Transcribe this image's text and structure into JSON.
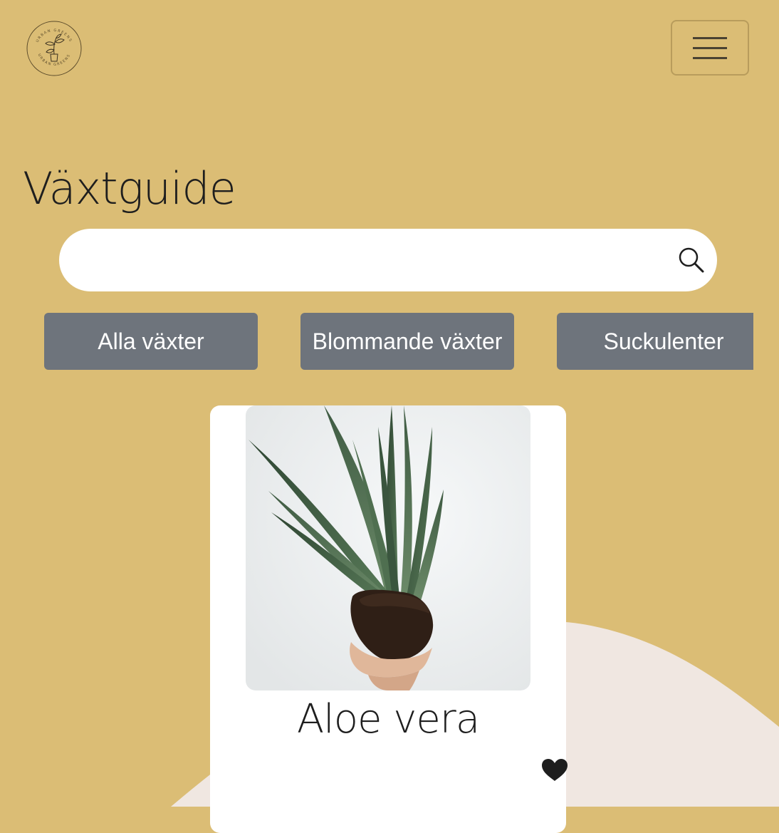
{
  "colors": {
    "background": "#dbbd75",
    "wave": "#f0e7e1",
    "filter_button": "#6e747c",
    "card": "#ffffff",
    "text": "#1e1e1e"
  },
  "header": {
    "logo_icon": "urban-greens-plant-logo",
    "logo_text": "URBAN GREENS",
    "menu_icon": "hamburger-icon"
  },
  "page": {
    "title": "Växtguide"
  },
  "search": {
    "value": "",
    "placeholder": "",
    "icon": "search-icon"
  },
  "filters": [
    {
      "label": "Alla växter"
    },
    {
      "label": "Blommande växter"
    },
    {
      "label": "Suckulenter"
    }
  ],
  "plants": [
    {
      "name": "Aloe vera",
      "image": "aloe-vera-held-in-hand-photo",
      "favorite_icon": "heart-icon"
    }
  ]
}
